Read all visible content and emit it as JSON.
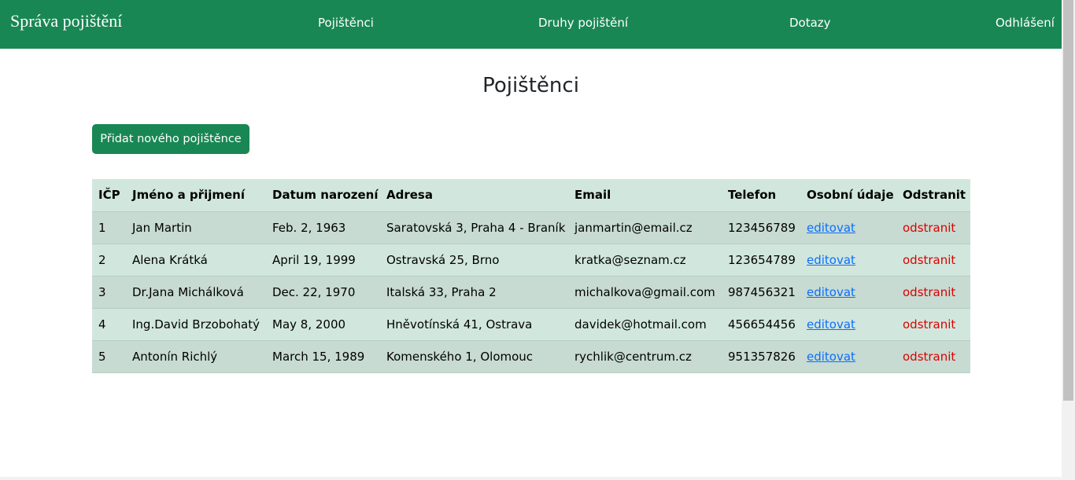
{
  "navbar": {
    "brand": "Správa pojištění",
    "links": [
      "Pojištěnci",
      "Druhy pojištění",
      "Dotazy",
      "Odhlášení"
    ]
  },
  "page": {
    "title": "Pojištěnci",
    "add_button": "Přidat nového pojištěnce"
  },
  "table": {
    "headers": [
      "IČP",
      "Jméno a přijmení",
      "Datum narození",
      "Adresa",
      "Email",
      "Telefon",
      "Osobní údaje",
      "Odstranit"
    ],
    "rows": [
      {
        "icp": "1",
        "name": "Jan Martin",
        "birth": "Feb. 2, 1963",
        "address": "Saratovská 3, Praha 4 - Braník",
        "email": "janmartin@email.cz",
        "phone": "123456789",
        "edit": "editovat",
        "remove": "odstranit"
      },
      {
        "icp": "2",
        "name": "Alena Krátká",
        "birth": "April 19, 1999",
        "address": "Ostravská 25, Brno",
        "email": "kratka@seznam.cz",
        "phone": "123654789",
        "edit": "editovat",
        "remove": "odstranit"
      },
      {
        "icp": "3",
        "name": "Dr.Jana Michálková",
        "birth": "Dec. 22, 1970",
        "address": "Italská 33, Praha 2",
        "email": "michalkova@gmail.com",
        "phone": "987456321",
        "edit": "editovat",
        "remove": "odstranit"
      },
      {
        "icp": "4",
        "name": "Ing.David Brzobohatý",
        "birth": "May 8, 2000",
        "address": "Hněvotínská 41, Ostrava",
        "email": "davidek@hotmail.com",
        "phone": "456654456",
        "edit": "editovat",
        "remove": "odstranit"
      },
      {
        "icp": "5",
        "name": "Antonín Richlý",
        "birth": "March 15, 1989",
        "address": "Komenského 1, Olomouc",
        "email": "rychlik@centrum.cz",
        "phone": "951357826",
        "edit": "editovat",
        "remove": "odstranit"
      }
    ]
  },
  "colors": {
    "brand": "#198754",
    "row_odd": "#c7dbd2",
    "row_even": "#d1e7dd",
    "link": "#0d6efd",
    "danger": "#dc0000"
  }
}
